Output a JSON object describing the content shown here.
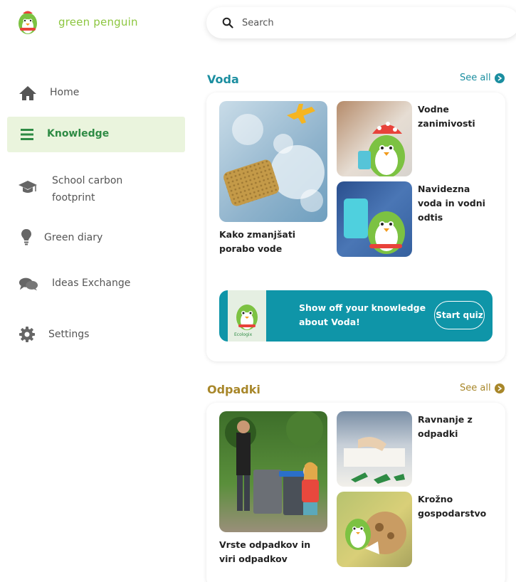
{
  "app": {
    "name": "green penguin"
  },
  "search": {
    "placeholder": "Search"
  },
  "nav": {
    "home": "Home",
    "knowledge": "Knowledge",
    "school_carbon_footprint": [
      "School carbon",
      "footprint"
    ],
    "green_diary": "Green diary",
    "ideas_exchange": "Ideas Exchange",
    "settings": "Settings"
  },
  "sections": {
    "voda": {
      "title": "Voda",
      "see_all": "See all",
      "accent": "#1b8ea0",
      "items": [
        {
          "lines": [
            "Kako zmanjšati",
            "porabo vode"
          ]
        },
        {
          "lines": [
            "Vodne",
            "zanimivosti"
          ]
        },
        {
          "lines": [
            "Navidezna",
            "voda in vodni",
            "odtis"
          ]
        }
      ],
      "quiz": {
        "text": "Show off your knowledge about Voda!",
        "button": "Start quiz",
        "logo_caption": "Ecologix"
      }
    },
    "odpadki": {
      "title": "Odpadki",
      "see_all": "See all",
      "accent": "#a8872a",
      "items": [
        {
          "lines": [
            "Vrste odpadkov in",
            "viri odpadkov"
          ]
        },
        {
          "lines": [
            "Ravnanje z",
            "odpadki"
          ]
        },
        {
          "lines": [
            "Krožno",
            "gospodarstvo"
          ]
        }
      ]
    }
  },
  "icons": {
    "logo": "penguin-logo-icon",
    "search": "search-icon",
    "home": "home-icon",
    "knowledge": "menu-icon",
    "school": "graduation-cap-icon",
    "diary": "lightbulb-icon",
    "ideas": "chat-bubbles-icon",
    "settings": "gear-icon",
    "see_all": "arrow-right-icon"
  },
  "colors": {
    "brand_green": "#8cc63f",
    "active_green": "#2e8b44",
    "teal": "#0f95a8"
  }
}
